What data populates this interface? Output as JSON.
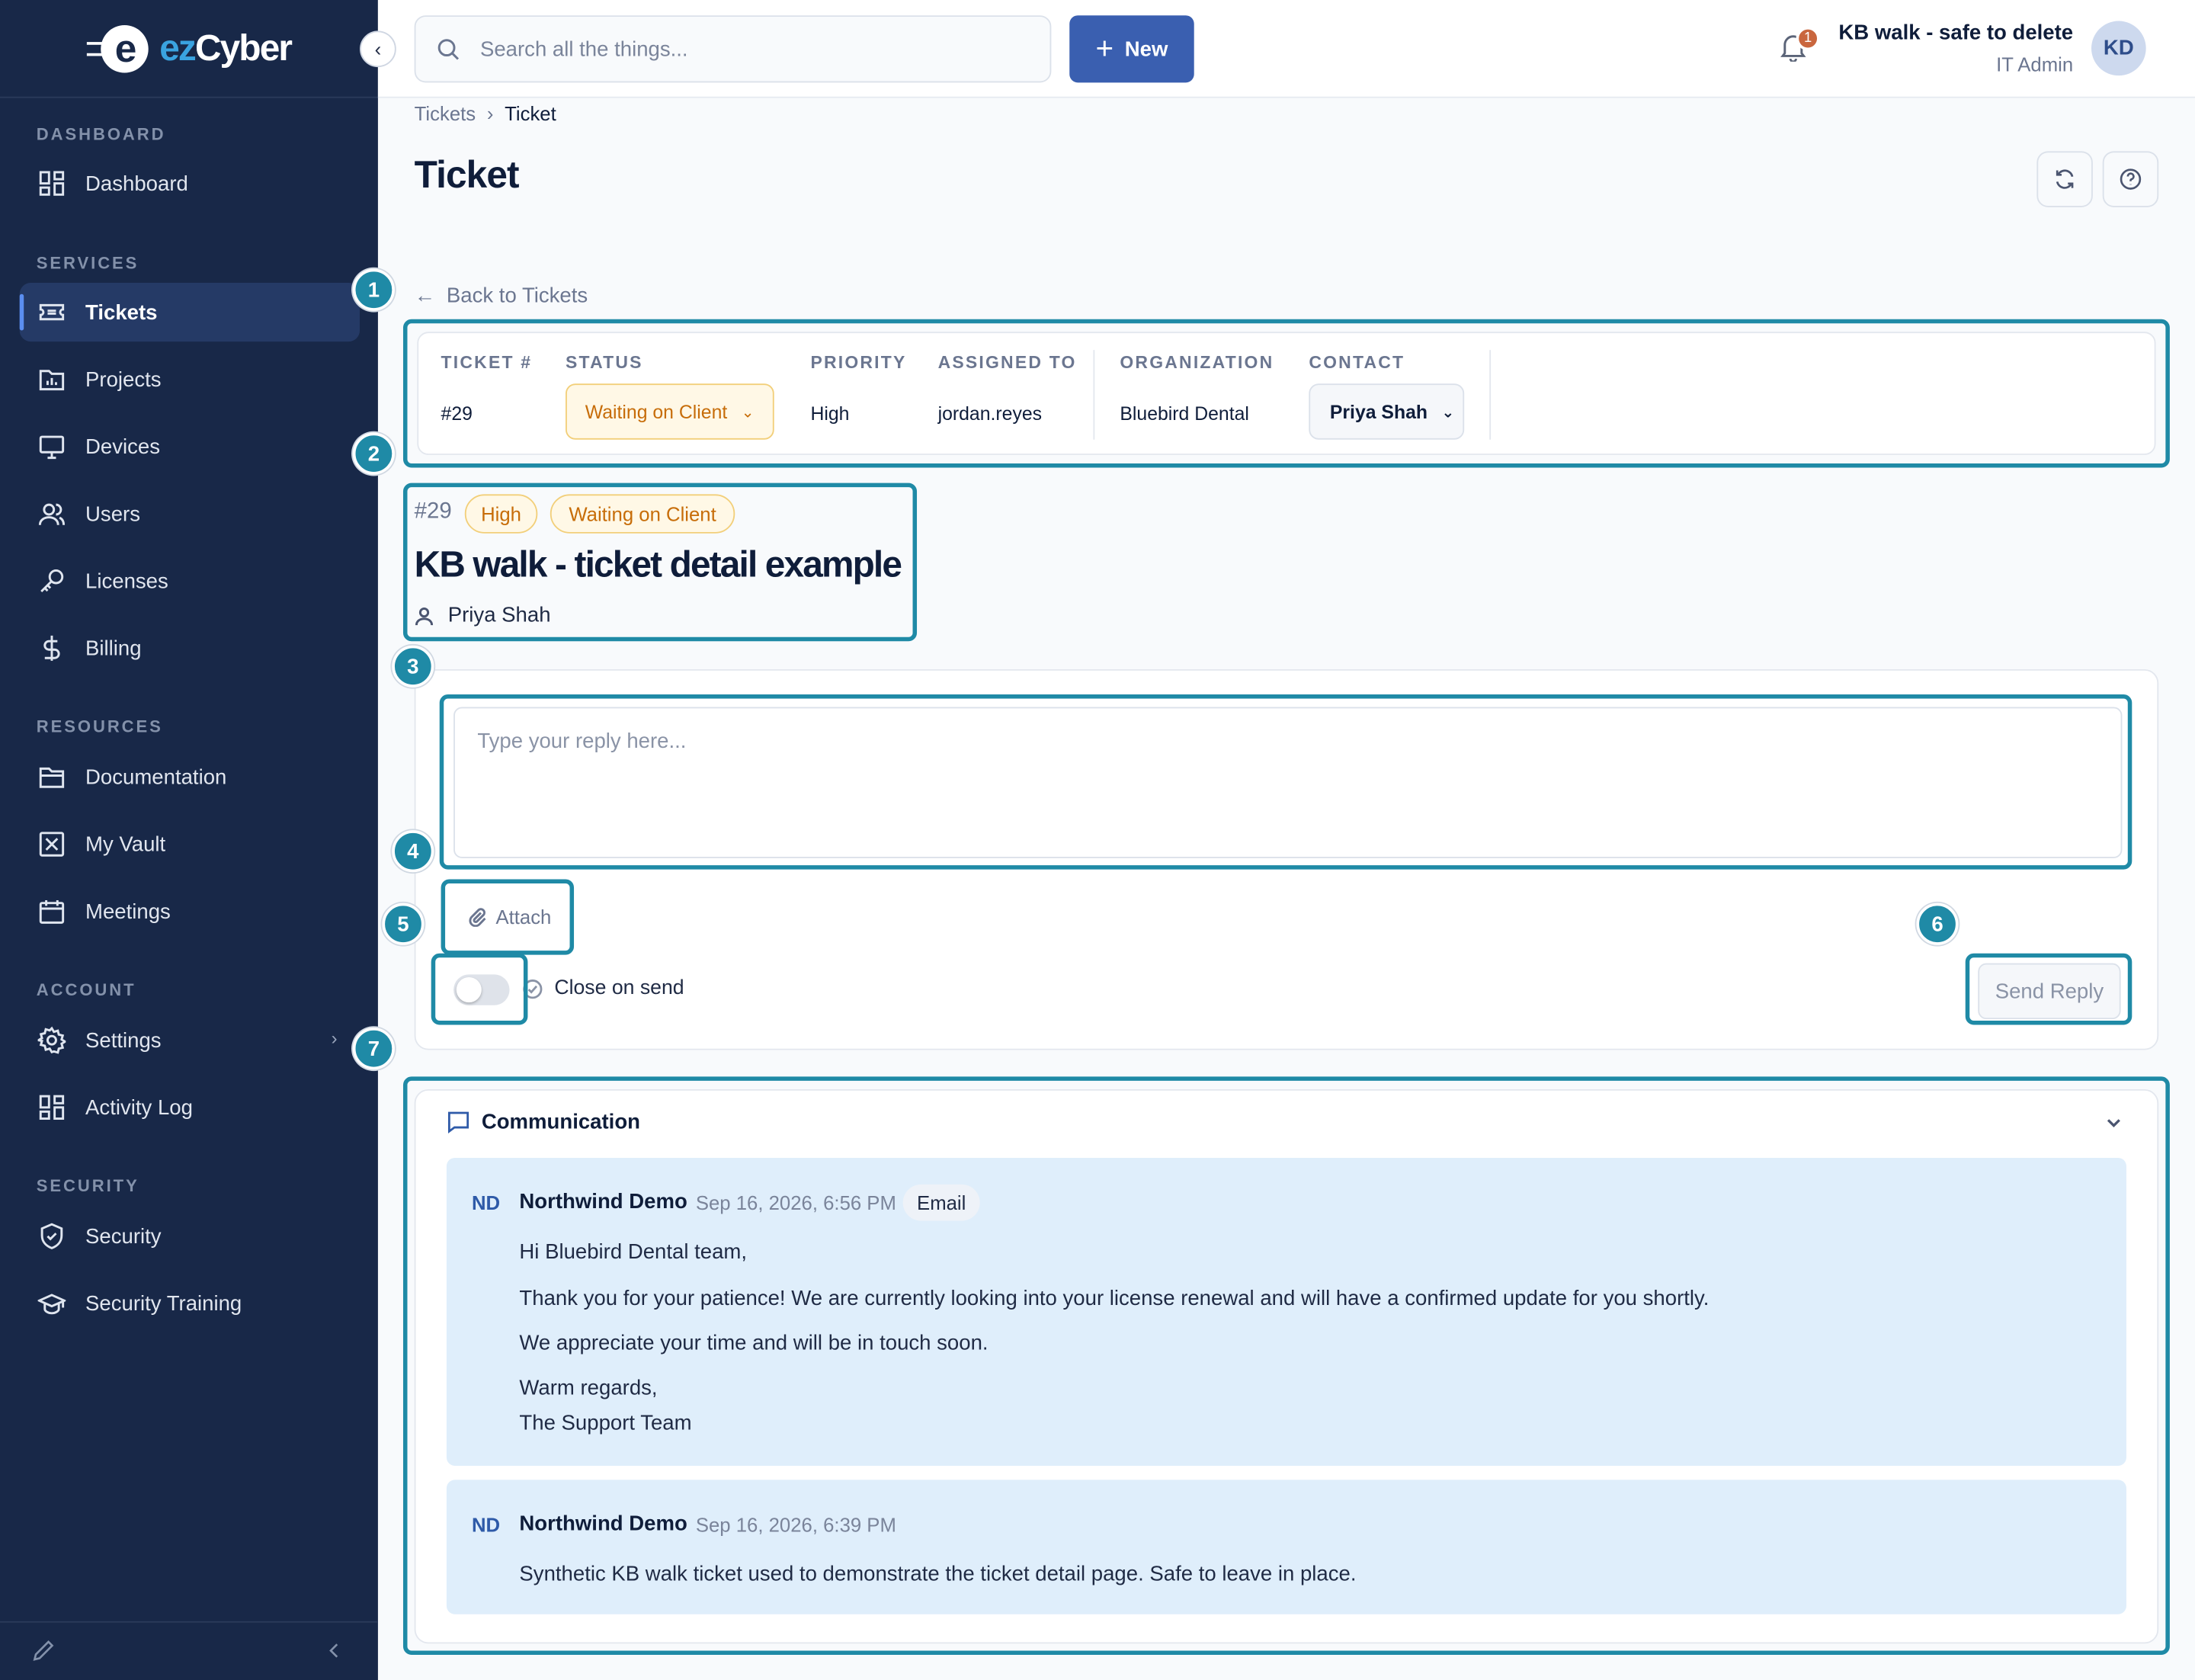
{
  "app": {
    "brand_ez": "ez",
    "brand_cyber": "Cyber"
  },
  "sidebar": {
    "sections": [
      {
        "title": "DASHBOARD"
      },
      {
        "title": "SERVICES"
      },
      {
        "title": "RESOURCES"
      },
      {
        "title": "ACCOUNT"
      },
      {
        "title": "SECURITY"
      }
    ],
    "items": [
      {
        "label": "Dashboard",
        "icon": "dashboard-icon"
      },
      {
        "label": "Tickets",
        "icon": "ticket-icon",
        "active": true
      },
      {
        "label": "Projects",
        "icon": "projects-icon"
      },
      {
        "label": "Devices",
        "icon": "monitor-icon"
      },
      {
        "label": "Users",
        "icon": "users-icon"
      },
      {
        "label": "Licenses",
        "icon": "key-icon"
      },
      {
        "label": "Billing",
        "icon": "dollar-icon"
      },
      {
        "label": "Documentation",
        "icon": "folder-icon"
      },
      {
        "label": "My Vault",
        "icon": "vault-icon"
      },
      {
        "label": "Meetings",
        "icon": "calendar-icon"
      },
      {
        "label": "Settings",
        "icon": "gear-icon"
      },
      {
        "label": "Activity Log",
        "icon": "activity-icon"
      },
      {
        "label": "Security",
        "icon": "shield-icon"
      },
      {
        "label": "Security Training",
        "icon": "graduation-cap-icon"
      }
    ]
  },
  "topbar": {
    "search_placeholder": "Search all the things...",
    "new_label": "New",
    "notification_count": "1",
    "user_name": "KB walk - safe to delete",
    "user_role": "IT Admin",
    "avatar_initials": "KD"
  },
  "breadcrumb": {
    "parent": "Tickets",
    "current": "Ticket"
  },
  "page_title": "Ticket",
  "back_link": "Back to Tickets",
  "info": {
    "ticket_label": "TICKET #",
    "ticket_value": "#29",
    "status_label": "STATUS",
    "status_value": "Waiting on Client",
    "priority_label": "PRIORITY",
    "priority_value": "High",
    "assigned_label": "ASSIGNED TO",
    "assigned_value": "jordan.reyes",
    "org_label": "ORGANIZATION",
    "org_value": "Bluebird Dental",
    "contact_label": "CONTACT",
    "contact_value": "Priya Shah"
  },
  "ticket": {
    "id": "#29",
    "priority_badge": "High",
    "status_badge": "Waiting on Client",
    "title": "KB walk - ticket detail example",
    "contact": "Priya Shah"
  },
  "reply": {
    "placeholder": "Type your reply here...",
    "attach_label": "Attach",
    "close_on_send_label": "Close on send",
    "close_on_send": false,
    "send_label": "Send Reply"
  },
  "markers": [
    "1",
    "2",
    "3",
    "4",
    "5",
    "6",
    "7"
  ],
  "communication": {
    "title": "Communication",
    "messages": [
      {
        "initials": "ND",
        "author": "Northwind Demo",
        "time": "Sep 16, 2026, 6:56 PM",
        "tag": "Email",
        "lines": [
          "Hi Bluebird Dental team,",
          "Thank you for your patience! We are currently looking into your license renewal and will have a confirmed update for you shortly.",
          "We appreciate your time and will be in touch soon.",
          "Warm regards,",
          "The Support Team"
        ]
      },
      {
        "initials": "ND",
        "author": "Northwind Demo",
        "time": "Sep 16, 2026, 6:39 PM",
        "lines": [
          "Synthetic KB walk ticket used to demonstrate the ticket detail page. Safe to leave in place."
        ]
      }
    ]
  },
  "colors": {
    "sidebar_bg": "#182848",
    "accent": "#3a5fb0",
    "highlight": "#1f8aa6",
    "status_amber": "#c76d09",
    "message_bg": "#dfeefb"
  }
}
